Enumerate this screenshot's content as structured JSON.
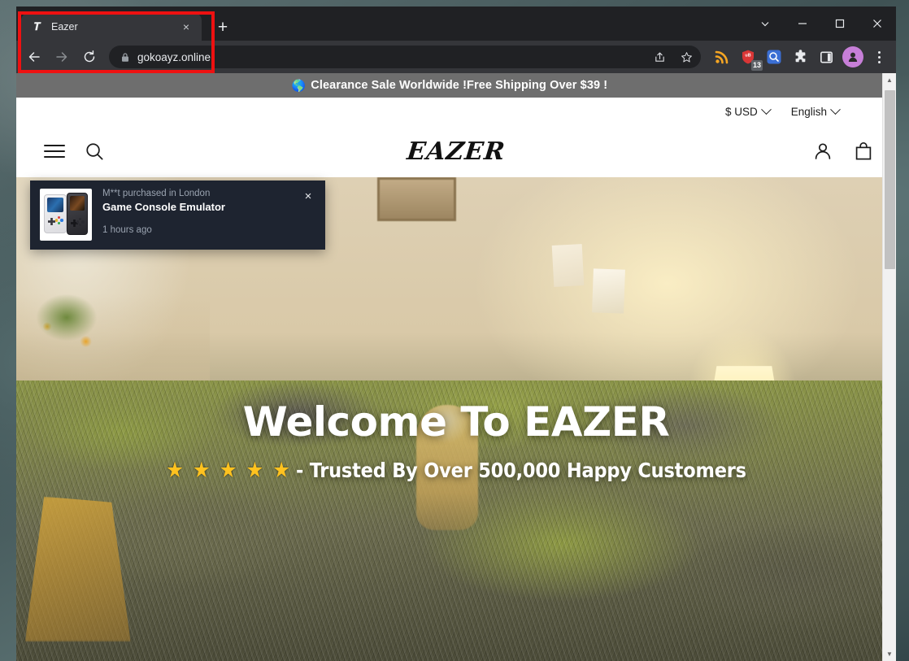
{
  "browser": {
    "tab": {
      "title": "Eazer",
      "favicon": "site-favicon",
      "close_label": "×"
    },
    "new_tab_label": "+",
    "window_controls": {
      "tab_search": "tab-search-chevron",
      "minimize": "minimize",
      "maximize": "maximize",
      "close": "close"
    },
    "toolbar": {
      "back": "back-arrow",
      "forward": "forward-arrow",
      "reload": "reload",
      "url": "gokoayz.online",
      "lock": "lock-icon",
      "share": "share-icon",
      "bookmark": "bookmark-star-icon",
      "extensions": [
        {
          "name": "rss-feed-extension",
          "color": "#f5a623"
        },
        {
          "name": "shield-blocker-extension",
          "color": "#d93636",
          "badge": "13"
        },
        {
          "name": "search-extension",
          "color": "#3b6fd4"
        },
        {
          "name": "extensions-puzzle-icon",
          "color": "#e8eaed"
        },
        {
          "name": "side-panel-icon",
          "color": "#e8eaed"
        }
      ],
      "profile": "profile-avatar",
      "menu": "three-dot-menu"
    }
  },
  "page": {
    "announcement": {
      "globe": "🌎",
      "text": "Clearance Sale Worldwide !Free Shipping Over $39 !"
    },
    "utility_bar": {
      "currency": "$ USD",
      "language": "English"
    },
    "header": {
      "menu_icon": "hamburger-menu-icon",
      "search_icon": "search-icon",
      "logo": "EAZER",
      "account_icon": "account-icon",
      "cart_icon": "shopping-bag-icon"
    },
    "hero": {
      "title": "Welcome To EAZER",
      "stars": [
        "★",
        "★",
        "★",
        "★",
        "★"
      ],
      "subtitle": "- Trusted By Over 500,000 Happy Customers"
    },
    "sales_popup": {
      "meta": "M**t purchased in London",
      "product": "Game Console Emulator",
      "time": "1 hours ago",
      "close_label": "×",
      "thumbnail": "game-console-emulator-thumbnail"
    },
    "scrollbar": {
      "up_arrow": "▲",
      "down_arrow": "▼"
    }
  },
  "annotation": {
    "color": "#ee1111",
    "target": "tab-and-address-bar"
  }
}
